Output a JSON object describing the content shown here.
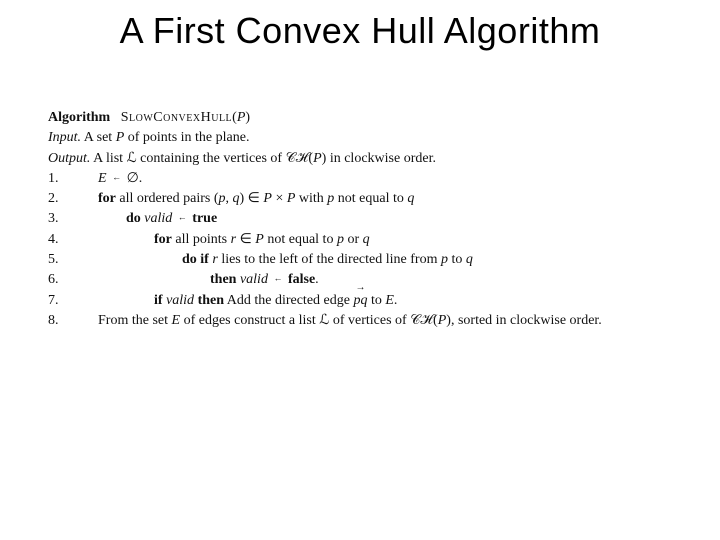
{
  "title": "A First Convex Hull Algorithm",
  "header": {
    "label": "Algorithm",
    "name_sc": "SlowConvexHull",
    "arg_open": "(",
    "arg": "P",
    "arg_close": ")"
  },
  "io": {
    "input_label": "Input.",
    "input_a": " A set ",
    "input_P": "P",
    "input_b": " of points in the plane.",
    "output_label": "Output.",
    "output_a": " A list ",
    "output_L": "ℒ",
    "output_b": " containing the vertices of ",
    "output_CH": "𝒞ℋ",
    "output_open": "(",
    "output_P": "P",
    "output_close": ")",
    "output_c": " in clockwise order."
  },
  "steps": {
    "s1": {
      "num": "1.",
      "E": "E",
      "arrow": "←",
      "empty": "∅",
      "dot": "."
    },
    "s2": {
      "num": "2.",
      "for": "for",
      "a": " all ordered pairs (",
      "p": "p",
      "comma": ", ",
      "q": "q",
      "b": ") ∈ ",
      "P1": "P",
      "times": " × ",
      "P2": "P",
      "c": " with ",
      "p2": "p",
      "d": " not equal to ",
      "q2": "q"
    },
    "s3": {
      "num": "3.",
      "do": "do",
      "valid": "valid",
      "arrow": "←",
      "true": "true"
    },
    "s4": {
      "num": "4.",
      "for": "for",
      "a": " all points ",
      "r": "r",
      "b": " ∈ ",
      "P": "P",
      "c": " not equal to ",
      "p": "p",
      "d": " or ",
      "q": "q"
    },
    "s5": {
      "num": "5.",
      "do": "do",
      "if": "if",
      "r": "r",
      "a": " lies to the left of the directed line from ",
      "p": "p",
      "b": " to ",
      "q": "q"
    },
    "s6": {
      "num": "6.",
      "then": "then",
      "valid": "valid",
      "arrow": "←",
      "false": "false",
      "dot": "."
    },
    "s7": {
      "num": "7.",
      "if": "if",
      "valid": "valid",
      "then": "then",
      "a": " Add the directed edge ",
      "pq": "pq",
      "b": " to ",
      "E": "E",
      "dot": "."
    },
    "s8": {
      "num": "8.",
      "a": "From the set ",
      "E": "E",
      "b": " of edges construct a list ",
      "L": "ℒ",
      "c": " of vertices of ",
      "CH": "𝒞ℋ",
      "open": "(",
      "P": "P",
      "close": ")",
      "d": ", sorted in clockwise order."
    }
  }
}
